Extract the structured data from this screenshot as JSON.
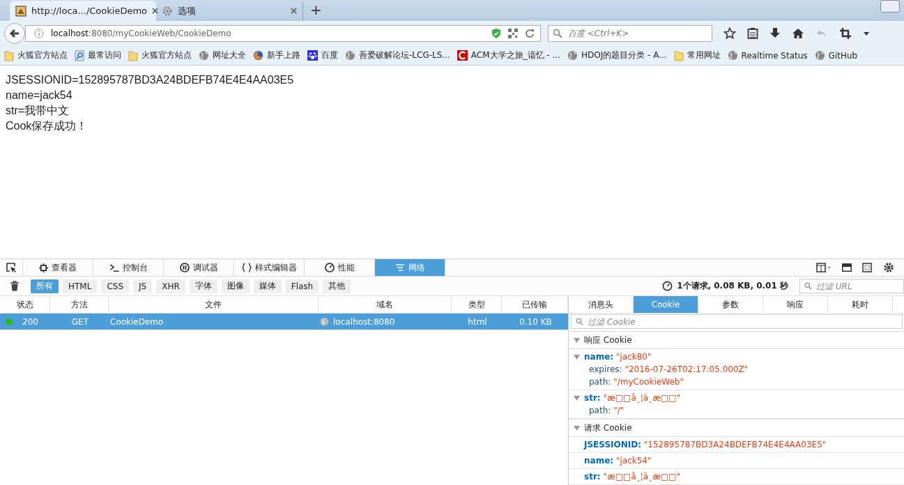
{
  "browser_tabs": [
    {
      "title": "http://loca.../CookieDemo",
      "kind": "page",
      "selected": true
    },
    {
      "title": "选项",
      "kind": "gear",
      "selected": false
    }
  ],
  "new_tab": "+",
  "address": {
    "host": "localhost",
    "rest": ":8080/myCookieWeb/CookieDemo"
  },
  "search": {
    "placeholder": "百度 <Ctrl+K>"
  },
  "bookmarks": [
    {
      "label": "火狐官方站点",
      "kind": "folder"
    },
    {
      "label": "最常访问",
      "kind": "search"
    },
    {
      "label": "火狐官方站点",
      "kind": "folder"
    },
    {
      "label": "网址大全",
      "kind": "globe"
    },
    {
      "label": "新手上路",
      "kind": "fox"
    },
    {
      "label": "百度",
      "kind": "paw"
    },
    {
      "label": "吾爱破解论坛-LCG-LS...",
      "kind": "globe"
    },
    {
      "label": "ACM大学之旅_谙忆 - ...",
      "kind": "red"
    },
    {
      "label": "HDOJ的题目分类 - A...",
      "kind": "globe"
    },
    {
      "label": "常用网址",
      "kind": "folder"
    },
    {
      "label": "Realtime Status",
      "kind": "globe"
    },
    {
      "label": "GitHub",
      "kind": "globe"
    }
  ],
  "page_lines": [
    "JSESSIONID=152895787BD3A24BDEFB74E4E4AA03E5",
    "name=jack54",
    "str=我带中文",
    "Cook保存成功！"
  ],
  "devtools": {
    "tools": [
      {
        "label": "查看器",
        "kind": "chip",
        "selected": false
      },
      {
        "label": "控制台",
        "kind": "prompt",
        "selected": false
      },
      {
        "label": "调试器",
        "kind": "pause",
        "selected": false
      },
      {
        "label": "样式编辑器",
        "kind": "braces",
        "selected": false
      },
      {
        "label": "性能",
        "kind": "gauge",
        "selected": false
      },
      {
        "label": "网络",
        "kind": "lines",
        "selected": true
      }
    ],
    "filters": [
      {
        "label": "所有",
        "selected": true
      },
      {
        "label": "HTML",
        "selected": false
      },
      {
        "label": "CSS",
        "selected": false
      },
      {
        "label": "JS",
        "selected": false
      },
      {
        "label": "XHR",
        "selected": false
      },
      {
        "label": "字体",
        "selected": false
      },
      {
        "label": "图像",
        "selected": false
      },
      {
        "label": "媒体",
        "selected": false
      },
      {
        "label": "Flash",
        "selected": false
      },
      {
        "label": "其他",
        "selected": false
      }
    ],
    "summary": "1个请求, 0.08 KB, 0.01 秒",
    "url_filter": {
      "placeholder": "过滤 URL"
    },
    "columns": [
      "状态",
      "方法",
      "文件",
      "域名",
      "类型",
      "已传输"
    ],
    "rows": [
      {
        "status": "200",
        "method": "GET",
        "file": "CookieDemo",
        "domain": "localhost:8080",
        "type": "html",
        "transferred": "0.10 KB",
        "selected": true
      }
    ],
    "detail_tabs": [
      {
        "label": "消息头",
        "selected": false
      },
      {
        "label": "Cookie",
        "selected": true
      },
      {
        "label": "参数",
        "selected": false
      },
      {
        "label": "响应",
        "selected": false
      },
      {
        "label": "耗时",
        "selected": false
      }
    ],
    "cookie_filter": {
      "placeholder": "过滤 Cookie"
    },
    "sections": [
      {
        "title": "响应 Cookie",
        "cookies": [
          {
            "name": "name:",
            "value": "\"jack80\"",
            "attrs": [
              {
                "key": "expires:",
                "value": "\"2016-07-26T02:17:05.000Z\""
              },
              {
                "key": "path:",
                "value": "\"/myCookieWeb\""
              }
            ]
          },
          {
            "name": "str:",
            "value": "\"æ□□å¸¦ä¸æ□□\"",
            "attrs": [
              {
                "key": "path:",
                "value": "\"/\""
              }
            ]
          }
        ]
      },
      {
        "title": "请求 Cookie",
        "cookies": [
          {
            "name": "JSESSIONID:",
            "value": "\"152895787BD3A24BDEFB74E4E4AA03E5\""
          },
          {
            "name": "name:",
            "value": "\"jack54\""
          },
          {
            "name": "str:",
            "value": "\"æ□□å¸¦ä¸æ□□\""
          }
        ]
      }
    ]
  }
}
